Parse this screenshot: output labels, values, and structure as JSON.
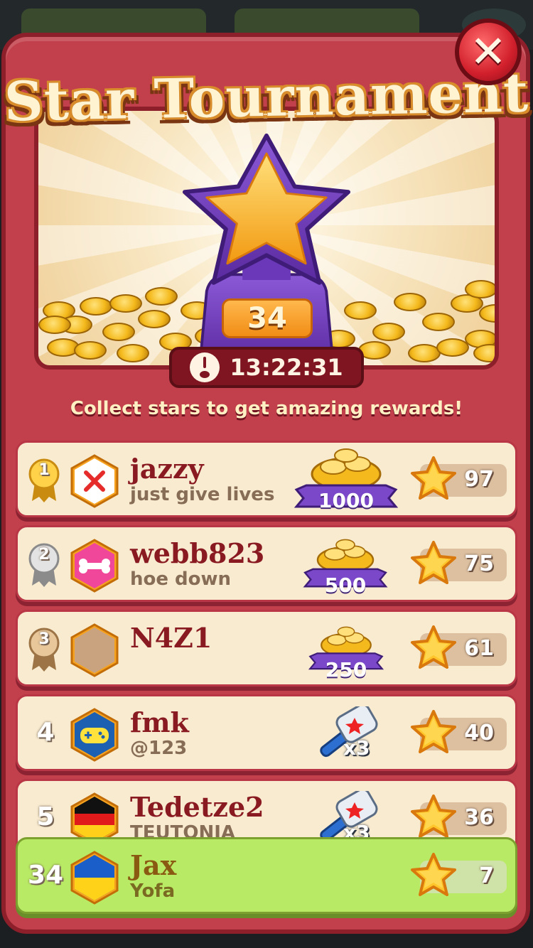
{
  "title": "Star Tournament",
  "close_label": "✕",
  "trophy_count": "34",
  "timer": "13:22:31",
  "subtitle": "Collect stars to get amazing rewards!",
  "colors": {
    "panel": "#c2404b",
    "row_bg": "#f8ebd0",
    "me_bg": "#b9ea65",
    "name": "#8a1a22"
  },
  "leaderboard": [
    {
      "rank": "1",
      "medal": "gold",
      "avatar": "crossed-swords-icon",
      "name": "jazzy",
      "subtitle": "just give lives",
      "reward_type": "coins",
      "reward": "1000",
      "stars": "97"
    },
    {
      "rank": "2",
      "medal": "silver",
      "avatar": "bone-icon",
      "name": "webb823",
      "subtitle": "hoe down",
      "reward_type": "coins",
      "reward": "500",
      "stars": "75"
    },
    {
      "rank": "3",
      "medal": "bronze",
      "avatar": "blank-avatar",
      "name": "N4Z1",
      "subtitle": "",
      "reward_type": "coins",
      "reward": "250",
      "stars": "61"
    },
    {
      "rank": "4",
      "medal": "none",
      "avatar": "gamepad-icon",
      "name": "fmk",
      "subtitle": "@123",
      "reward_type": "hammer",
      "reward": "x3",
      "stars": "40"
    },
    {
      "rank": "5",
      "medal": "none",
      "avatar": "germany-flag",
      "name": "Tedetze2",
      "subtitle": "TEUTONIA",
      "reward_type": "hammer",
      "reward": "x3",
      "stars": "36"
    }
  ],
  "me": {
    "rank": "34",
    "avatar": "ukraine-flag",
    "name": "Jax",
    "subtitle": "Yofa",
    "stars": "7"
  }
}
